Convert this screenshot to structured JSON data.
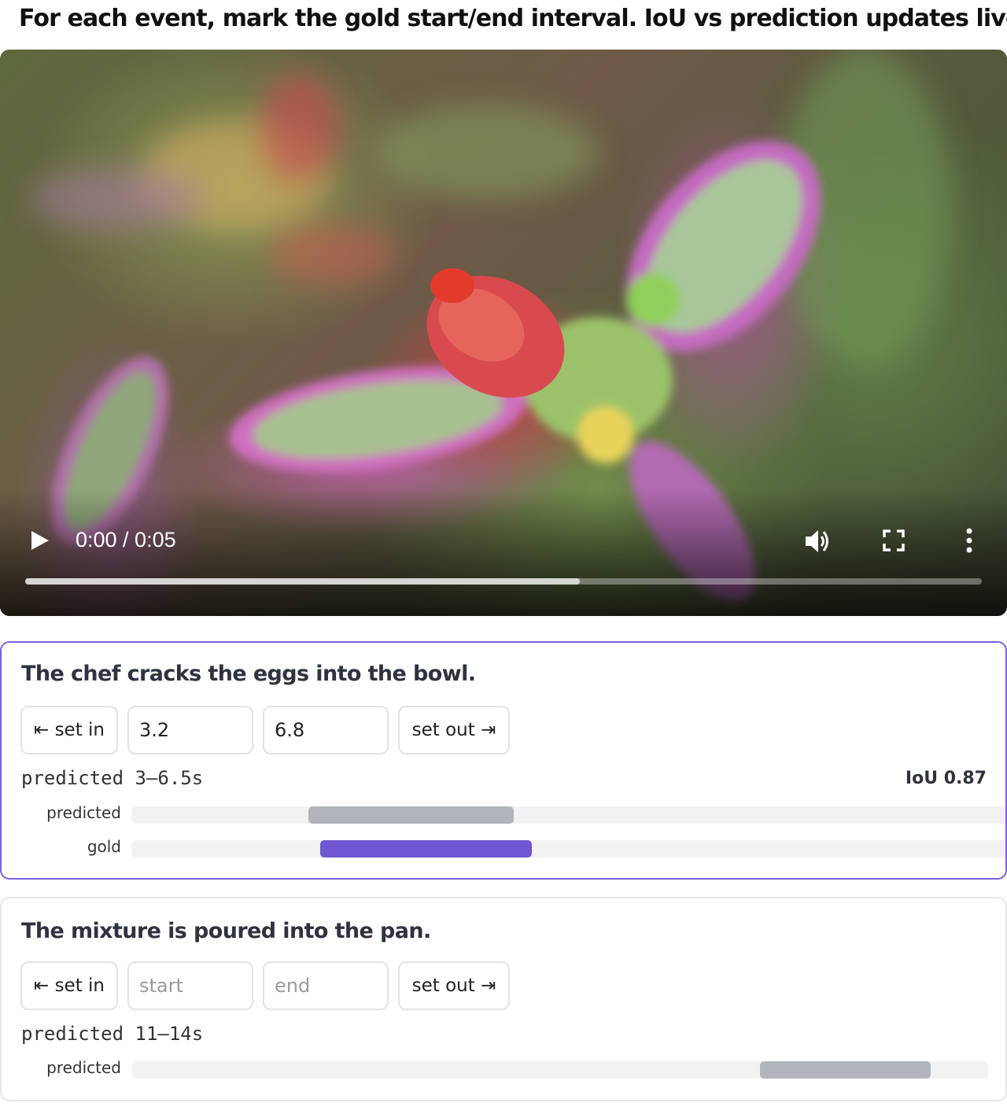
{
  "instructions": "For each event, mark the gold start/end interval. IoU vs prediction updates live.",
  "video": {
    "time_display": "0:00 / 0:05",
    "current_time_s": 0,
    "duration_s": 5,
    "buffered_fraction": 0.58,
    "controls": [
      "play-icon",
      "volume-icon",
      "fullscreen-icon",
      "more-options-icon"
    ]
  },
  "timeline": {
    "max_s": 15
  },
  "events": [
    {
      "caption": "The chef cracks the eggs into the bowl.",
      "set_in_label": "⇤ set in",
      "set_out_label": "set out ⇥",
      "start_value": "3.2",
      "end_value": "6.8",
      "start_placeholder": "start",
      "end_placeholder": "end",
      "predicted_text": "predicted 3–6.5s",
      "iou_text": "IoU 0.87",
      "predicted_interval": [
        3,
        6.5
      ],
      "gold_interval": [
        3.2,
        6.8
      ],
      "track_predicted_label": "predicted",
      "track_gold_label": "gold",
      "selected": true
    },
    {
      "caption": "The mixture is poured into the pan.",
      "set_in_label": "⇤ set in",
      "set_out_label": "set out ⇥",
      "start_value": "",
      "end_value": "",
      "start_placeholder": "start",
      "end_placeholder": "end",
      "predicted_text": "predicted 11–14s",
      "predicted_interval": [
        11,
        14
      ],
      "track_predicted_label": "predicted",
      "selected": false
    }
  ],
  "colors": {
    "accent": "#6f58d1",
    "selected_border": "#7b61e0",
    "predicted_bar": "#b1b5bb",
    "track_bg": "#f2f2f2"
  }
}
